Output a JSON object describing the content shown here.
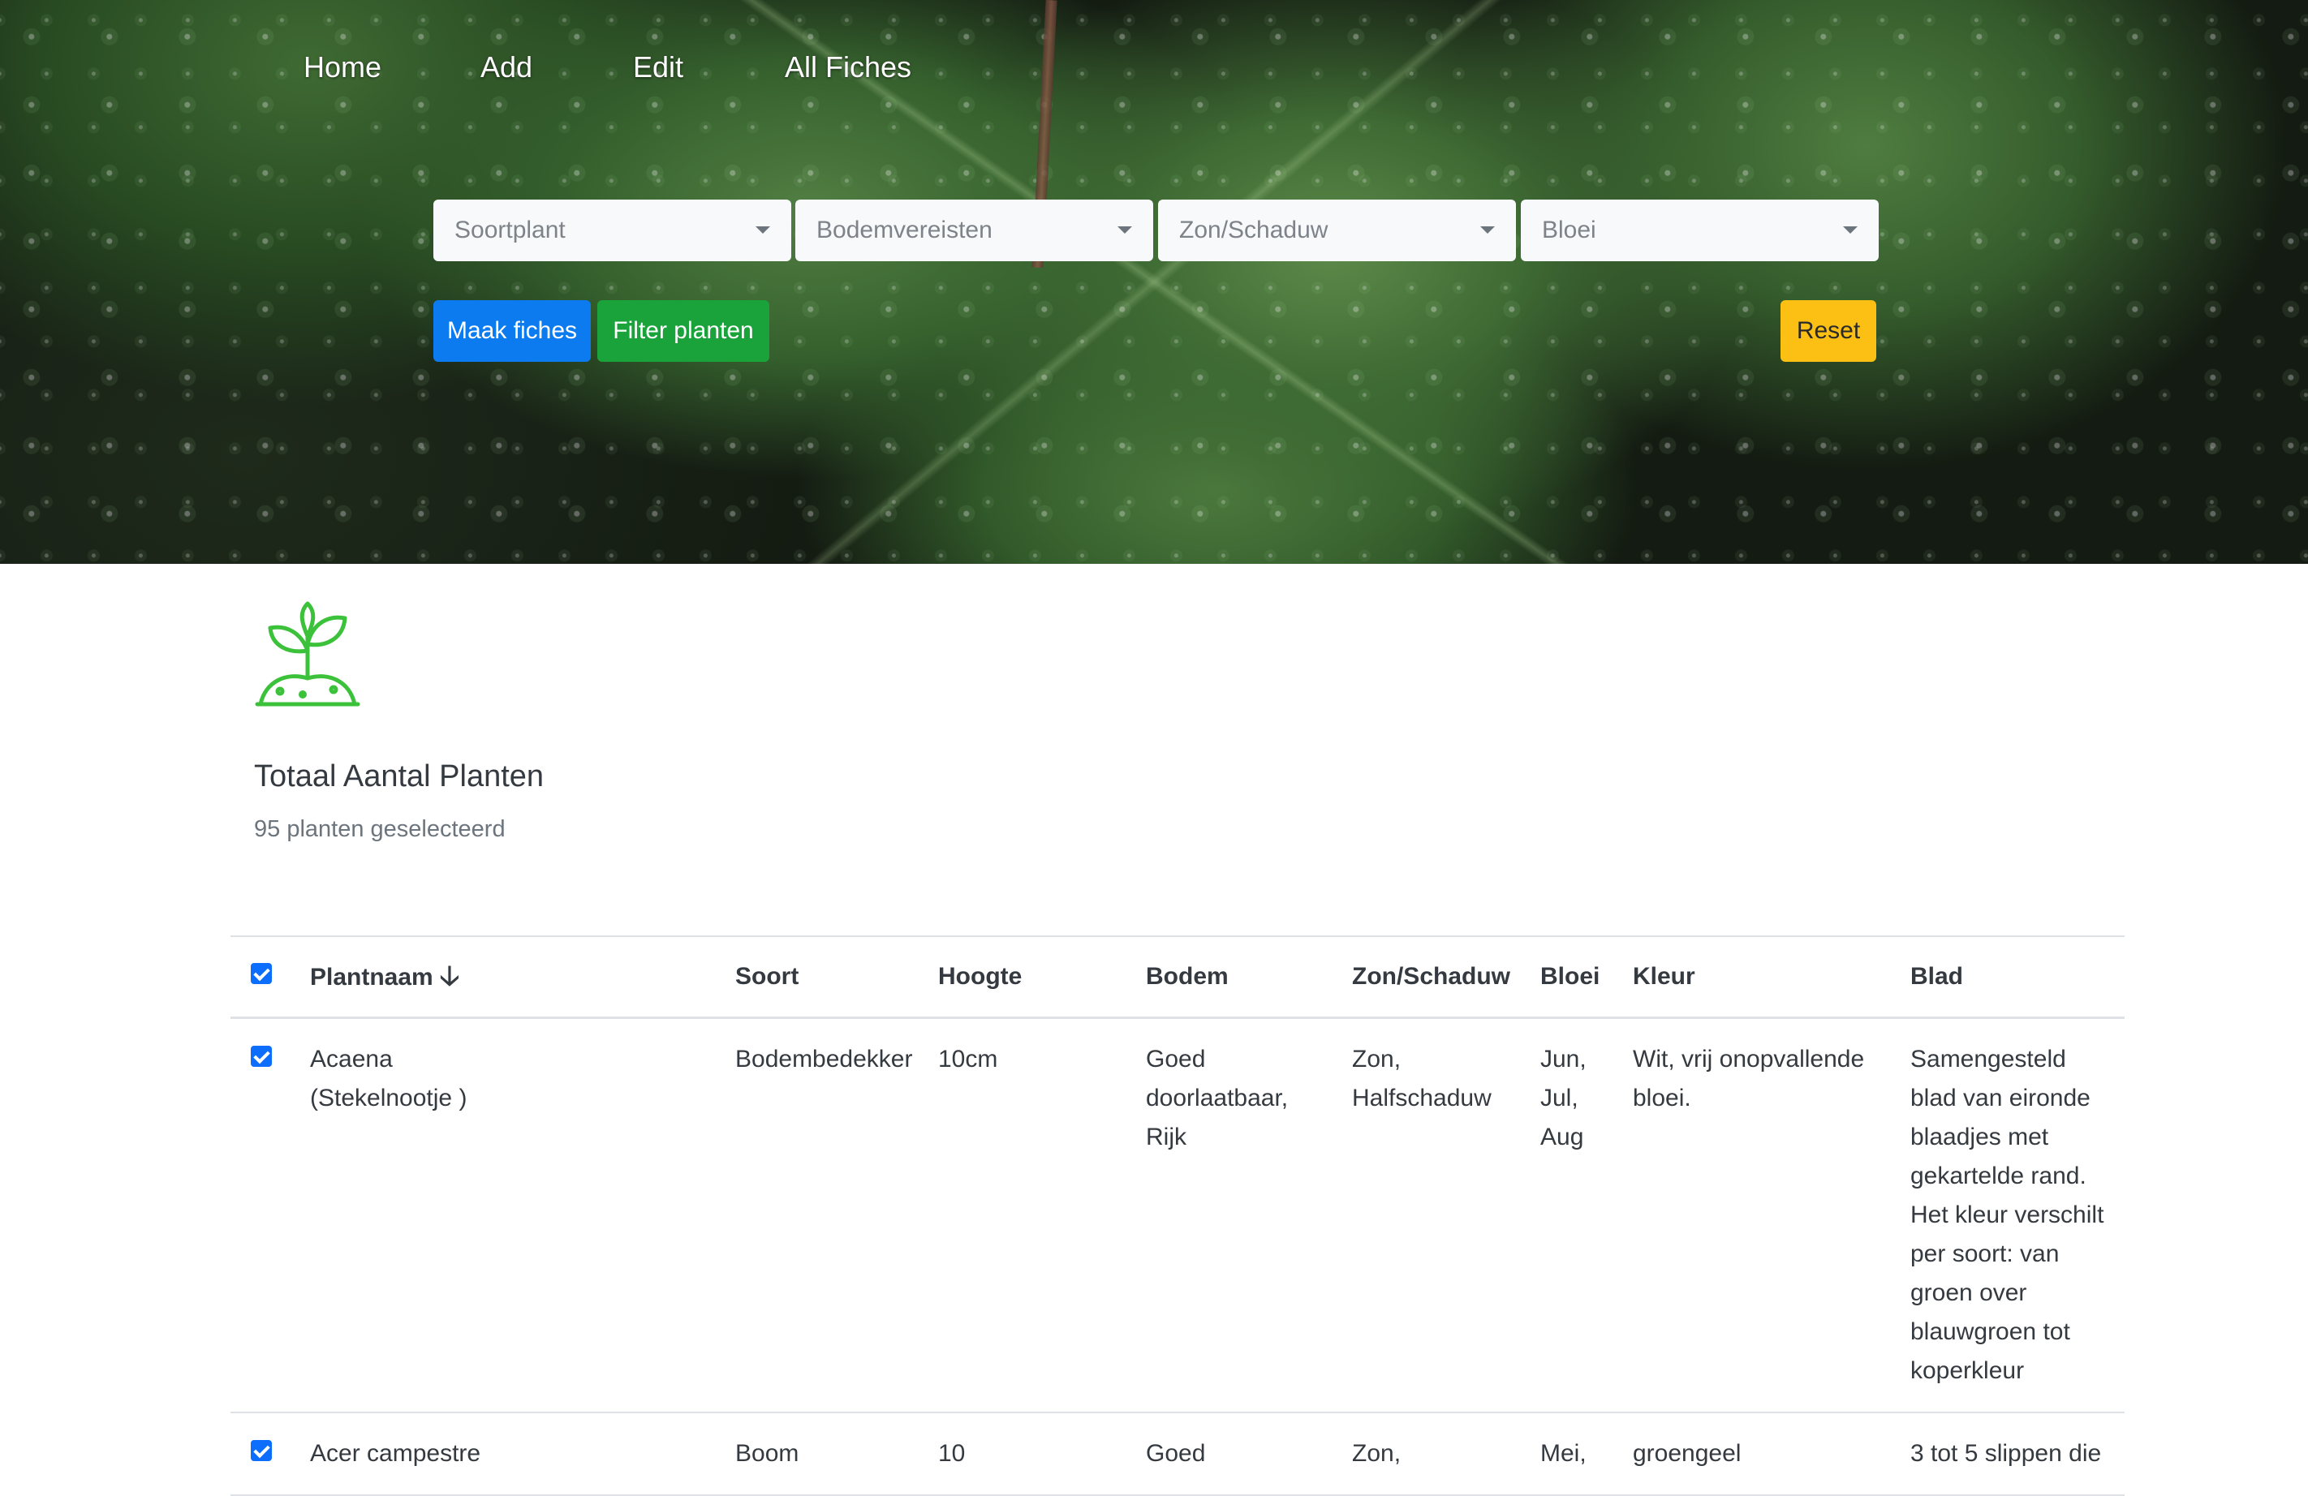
{
  "nav": {
    "items": [
      {
        "label": "Home"
      },
      {
        "label": "Add"
      },
      {
        "label": "Edit"
      },
      {
        "label": "All Fiches"
      }
    ]
  },
  "filters": {
    "soortplant": "Soortplant",
    "bodemvereisten": "Bodemvereisten",
    "zon_schaduw": "Zon/Schaduw",
    "bloei": "Bloei"
  },
  "actions": {
    "maak_fiches": "Maak fiches",
    "filter_planten": "Filter planten",
    "reset": "Reset"
  },
  "summary": {
    "title": "Totaal Aantal Planten",
    "count_text": "95 planten geselecteerd"
  },
  "table": {
    "headers": {
      "plantnaam": "Plantnaam",
      "sort_arrow": "🡣",
      "soort": "Soort",
      "hoogte": "Hoogte",
      "bodem": "Bodem",
      "zon_schaduw": "Zon/Schaduw",
      "bloei": "Bloei",
      "kleur": "Kleur",
      "blad": "Blad"
    },
    "rows": [
      {
        "naam": "Acaena (Stekelnootje )",
        "soort": "Bodembedekker",
        "hoogte": "10cm",
        "bodem": "Goed doorlaatbaar, Rijk",
        "zon": "Zon, Halfschaduw",
        "bloei": "Jun, Jul, Aug",
        "kleur": "Wit, vrij onopvallende bloei.",
        "blad": "Samengesteld blad van eironde blaadjes met gekartelde rand. Het kleur verschilt per soort: van groen over blauwgroen tot koperkleur"
      },
      {
        "naam": "Acer campestre",
        "soort": "Boom",
        "hoogte": "10",
        "bodem": "Goed",
        "zon": "Zon,",
        "bloei": "Mei,",
        "kleur": "groengeel",
        "blad": "3 tot 5 slippen die"
      }
    ]
  },
  "colors": {
    "primary": "#0d7bf0",
    "success": "#19a33a",
    "warning": "#fcc015",
    "icon_green": "#3cc13a"
  },
  "icons": {
    "plant": "sprout-icon",
    "sort": "arrow-down-icon",
    "caret": "caret-down-icon"
  }
}
